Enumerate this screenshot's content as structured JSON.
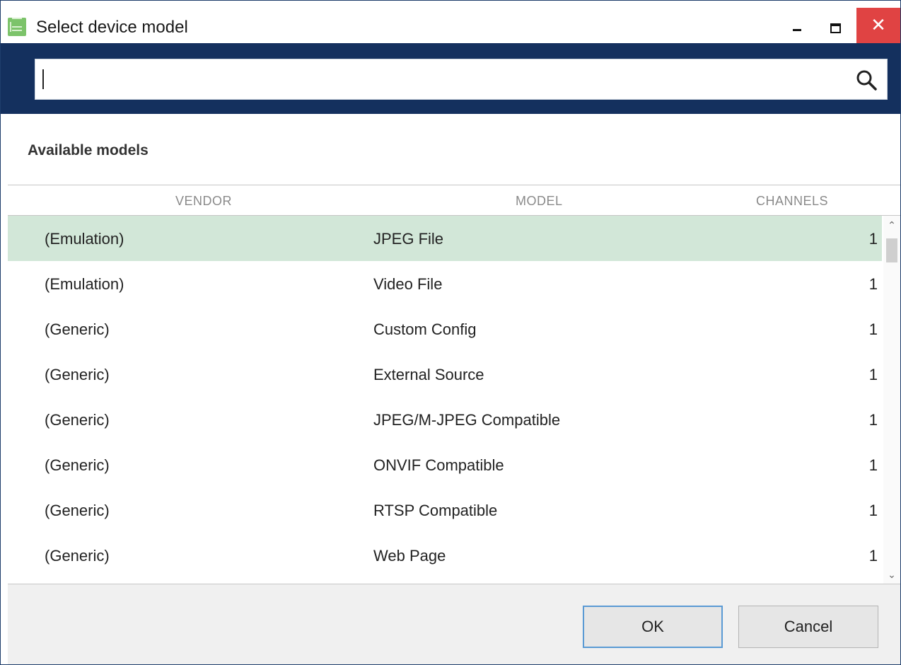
{
  "window": {
    "title": "Select device model"
  },
  "titlebar_buttons": {
    "minimize": "minimize-icon",
    "maximize": "maximize-icon",
    "close_glyph": "✕"
  },
  "search": {
    "value": "",
    "placeholder": "",
    "icon": "search-icon"
  },
  "section": {
    "title": "Available models"
  },
  "table": {
    "columns": {
      "vendor": "VENDOR",
      "model": "MODEL",
      "channels": "CHANNELS"
    },
    "selected_index": 0,
    "rows": [
      {
        "vendor": "(Emulation)",
        "model": "JPEG File",
        "channels": "1"
      },
      {
        "vendor": "(Emulation)",
        "model": "Video File",
        "channels": "1"
      },
      {
        "vendor": "(Generic)",
        "model": "Custom Config",
        "channels": "1"
      },
      {
        "vendor": "(Generic)",
        "model": "External Source",
        "channels": "1"
      },
      {
        "vendor": "(Generic)",
        "model": "JPEG/M-JPEG Compatible",
        "channels": "1"
      },
      {
        "vendor": "(Generic)",
        "model": "ONVIF Compatible",
        "channels": "1"
      },
      {
        "vendor": "(Generic)",
        "model": "RTSP Compatible",
        "channels": "1"
      },
      {
        "vendor": "(Generic)",
        "model": "Web Page",
        "channels": "1"
      }
    ]
  },
  "buttons": {
    "ok": "OK",
    "cancel": "Cancel"
  },
  "colors": {
    "accent": "#14305e",
    "selected_row": "#d2e7d8",
    "close": "#e04343",
    "ok_border": "#5a9ad4"
  }
}
